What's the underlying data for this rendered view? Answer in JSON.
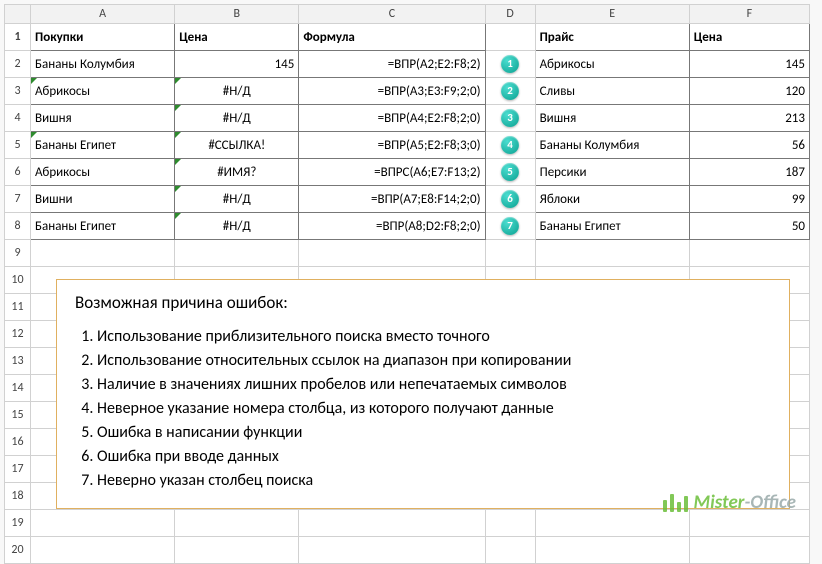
{
  "columns": [
    "A",
    "B",
    "C",
    "D",
    "E",
    "F"
  ],
  "row_headers": [
    "1",
    "2",
    "3",
    "4",
    "5",
    "6",
    "7",
    "8",
    "9",
    "10",
    "11",
    "12",
    "13",
    "14",
    "15",
    "16",
    "17",
    "18",
    "19",
    "20"
  ],
  "header_row": {
    "A": "Покупки",
    "B": "Цена",
    "C": "Формула",
    "D": "",
    "E": "Прайс",
    "F": "Цена"
  },
  "rows": [
    {
      "A": "Бананы Колумбия",
      "B": "145",
      "C": "=ВПР(A2;E2:F8;2)",
      "D": "1",
      "E": "Абрикосы",
      "F": "145",
      "triA": false,
      "triB": false,
      "bRight": true
    },
    {
      "A": "Абрикосы",
      "B": "#Н/Д",
      "C": "=ВПР(A3;E3:F9;2;0)",
      "D": "2",
      "E": "Сливы",
      "F": "120",
      "triA": true,
      "triB": true,
      "bCenter": true
    },
    {
      "A": "Вишня",
      "B": "#Н/Д",
      "C": "=ВПР(A4;E2:F8;2;0)",
      "D": "3",
      "E": "Вишня",
      "F": "213",
      "triA": false,
      "triB": true,
      "bCenter": true
    },
    {
      "A": "Бананы Египет",
      "B": "#ССЫЛКА!",
      "C": "=ВПР(A5;E2:F8;3;0)",
      "D": "4",
      "E": "Бананы Колумбия",
      "F": "56",
      "triA": true,
      "triB": true,
      "bCenter": true
    },
    {
      "A": "Абрикосы",
      "B": "#ИМЯ?",
      "C": "=ВПРС(A6;E7:F13;2)",
      "D": "5",
      "E": "Персики",
      "F": "187",
      "triA": false,
      "triB": true,
      "bCenter": true
    },
    {
      "A": "Вишни",
      "B": "#Н/Д",
      "C": "=ВПР(A7;E8:F14;2;0)",
      "D": "6",
      "E": "Яблоки",
      "F": "99",
      "triA": false,
      "triB": true,
      "bCenter": true
    },
    {
      "A": "Бананы Египет",
      "B": "#Н/Д",
      "C": "=ВПР(A8;D2:F8;2;0)",
      "D": "7",
      "E": "Бананы Египет",
      "F": "50",
      "triA": false,
      "triB": true,
      "bCenter": true
    }
  ],
  "textbox": {
    "title": "Возможная причина ошибок:",
    "items": [
      "Использование приблизительного поиска вместо точного",
      "Использование относительных ссылок на диапазон при копировании",
      "Наличие в значениях лишних пробелов или непечатаемых символов",
      "Неверное указание номера столбца, из которого получают данные",
      "Ошибка в написании функции",
      "Ошибка при вводе данных",
      "Неверно указан столбец поиска"
    ]
  },
  "logo": {
    "brand": "Mister",
    "suffix": "-Office"
  }
}
